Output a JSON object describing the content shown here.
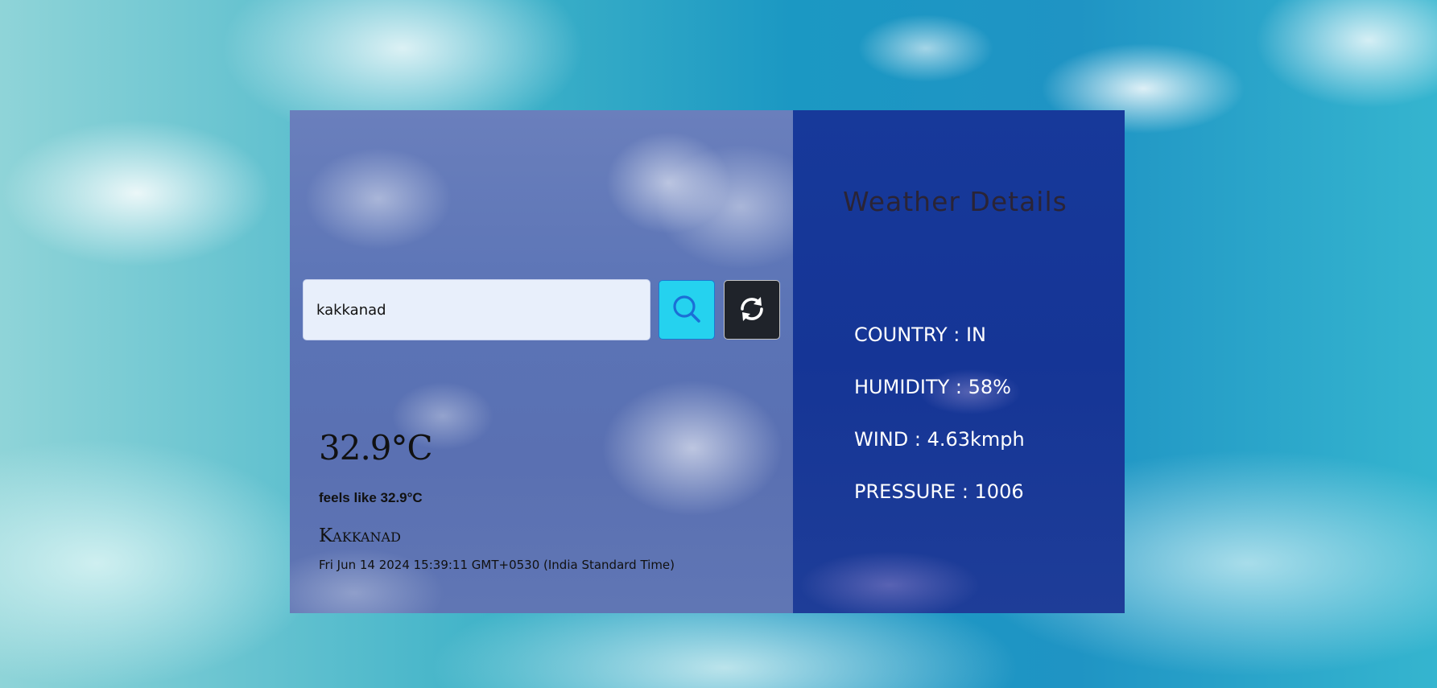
{
  "search": {
    "value": "kakkanad",
    "placeholder": ""
  },
  "icons": {
    "search": "search-icon",
    "refresh": "refresh-icon"
  },
  "current": {
    "temperature": "32.9°C",
    "feels_like": "feels like 32.9°C",
    "city": "Kakkanad",
    "datetime": "Fri Jun 14 2024 15:39:11 GMT+0530 (India Standard Time)"
  },
  "details": {
    "title": "Weather Details",
    "rows": [
      "COUNTRY : IN",
      "HUMIDITY : 58%",
      "WIND : 4.63kmph",
      "PRESSURE : 1006"
    ]
  },
  "colors": {
    "search_button": "#25d2ef",
    "refresh_button": "#1f232a",
    "details_panel": "#17399a",
    "search_field": "#e8effb"
  }
}
